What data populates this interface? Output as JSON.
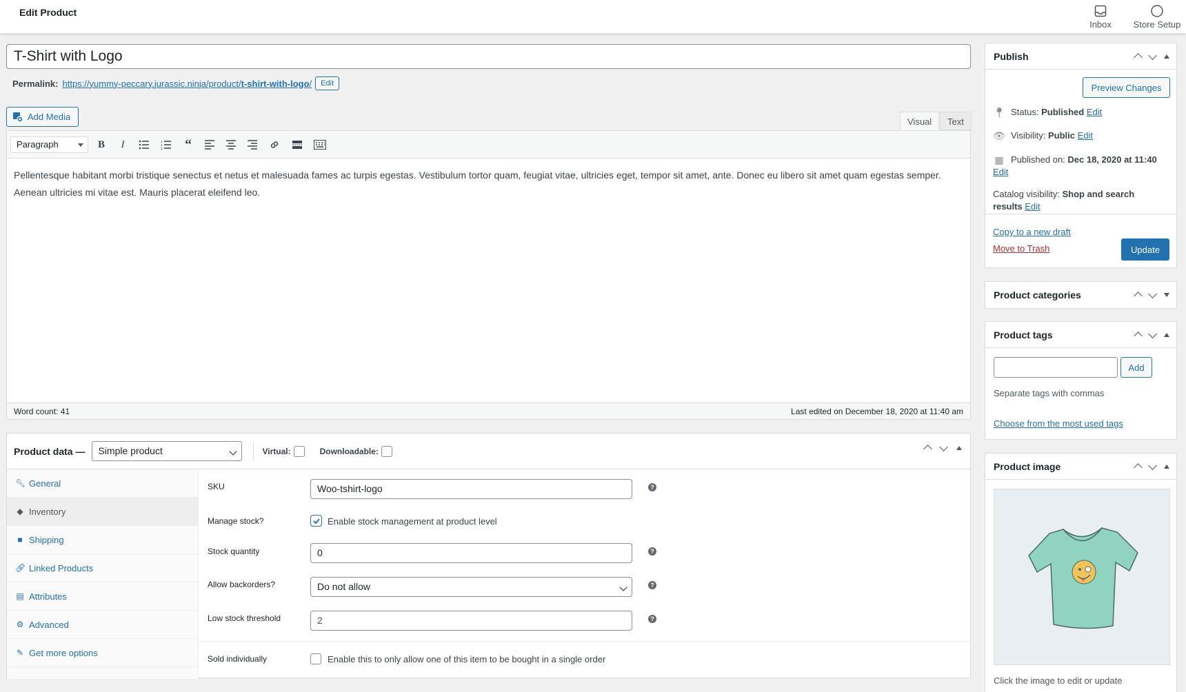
{
  "header": {
    "title": "Edit Product",
    "actions": [
      {
        "label": "Inbox",
        "icon": "inbox-icon"
      },
      {
        "label": "Store Setup",
        "icon": "circle-icon"
      }
    ]
  },
  "post": {
    "title": "T-Shirt with Logo",
    "permalink_label": "Permalink:",
    "permalink_base": "https://yummy-peccary.jurassic.ninja/product/",
    "permalink_slug": "t-shirt-with-logo",
    "permalink_trailing": "/",
    "permalink_edit": "Edit"
  },
  "editor": {
    "add_media": "Add Media",
    "tabs": {
      "visual": "Visual",
      "text": "Text"
    },
    "format": "Paragraph",
    "content": "Pellentesque habitant morbi tristique senectus et netus et malesuada fames ac turpis egestas. Vestibulum tortor quam, feugiat vitae, ultricies eget, tempor sit amet, ante. Donec eu libero sit amet quam egestas semper. Aenean ultricies mi vitae est. Mauris placerat eleifend leo.",
    "word_count": "Word count: 41",
    "last_edited": "Last edited on December 18, 2020 at 11:40 am"
  },
  "product_data": {
    "title": "Product data —",
    "type": "Simple product",
    "virtual_label": "Virtual:",
    "downloadable_label": "Downloadable:",
    "tabs": [
      {
        "label": "General",
        "icon": "wrench-icon"
      },
      {
        "label": "Inventory",
        "icon": "tag-icon"
      },
      {
        "label": "Shipping",
        "icon": "truck-icon"
      },
      {
        "label": "Linked Products",
        "icon": "link-icon"
      },
      {
        "label": "Attributes",
        "icon": "list-icon"
      },
      {
        "label": "Advanced",
        "icon": "gear-icon"
      },
      {
        "label": "Get more options",
        "icon": "plugin-icon"
      }
    ],
    "fields": {
      "sku_label": "SKU",
      "sku_value": "Woo-tshirt-logo",
      "manage_stock_label": "Manage stock?",
      "manage_stock_text": "Enable stock management at product level",
      "stock_qty_label": "Stock quantity",
      "stock_qty_value": "0",
      "backorders_label": "Allow backorders?",
      "backorders_value": "Do not allow",
      "low_stock_label": "Low stock threshold",
      "low_stock_value": "2",
      "sold_ind_label": "Sold individually",
      "sold_ind_text": "Enable this to only allow one of this item to be bought in a single order"
    }
  },
  "publish": {
    "title": "Publish",
    "preview": "Preview Changes",
    "status_label": "Status:",
    "status_value": "Published",
    "visibility_label": "Visibility:",
    "visibility_value": "Public",
    "published_label": "Published on:",
    "published_value": "Dec 18, 2020 at 11:40",
    "catalog_label": "Catalog visibility:",
    "catalog_value1": "Shop and search",
    "catalog_value2": "results",
    "edit": "Edit",
    "copy_draft": "Copy to a new draft",
    "trash": "Move to Trash",
    "update": "Update"
  },
  "categories": {
    "title": "Product categories"
  },
  "tags": {
    "title": "Product tags",
    "add": "Add",
    "hint": "Separate tags with commas",
    "choose": "Choose from the most used tags"
  },
  "image": {
    "title": "Product image",
    "hint": "Click the image to edit or update"
  },
  "colors": {
    "accent": "#2271b1",
    "trash": "#b32d2e",
    "tshirt": "#8fd3c0"
  }
}
